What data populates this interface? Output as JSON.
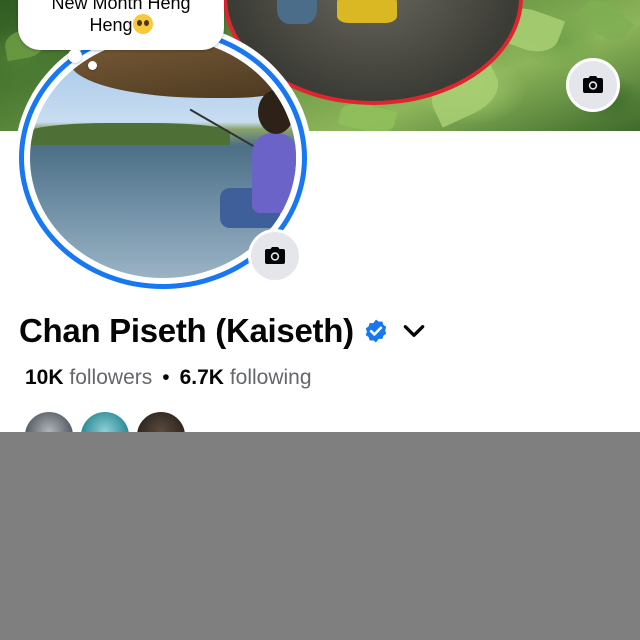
{
  "status_bubble": {
    "text_line1": "New Month Heng",
    "text_line2": "Heng",
    "emoji": "pleading-face-emoji"
  },
  "profile": {
    "name": "Chan Piseth (Kaiseth)",
    "verified": true,
    "followers_count": "10K",
    "followers_label": "followers",
    "separator": "•",
    "following_count": "6.7K",
    "following_label": "following"
  },
  "icons": {
    "cover_camera": "camera-icon",
    "profile_camera": "camera-icon",
    "verified": "verified-badge-icon",
    "name_menu": "chevron-down-icon"
  },
  "colors": {
    "accent": "#1877f2",
    "story_ring": "#1877f2",
    "cover_ring": "#e0252f",
    "overlay": "#7f7f7f"
  }
}
